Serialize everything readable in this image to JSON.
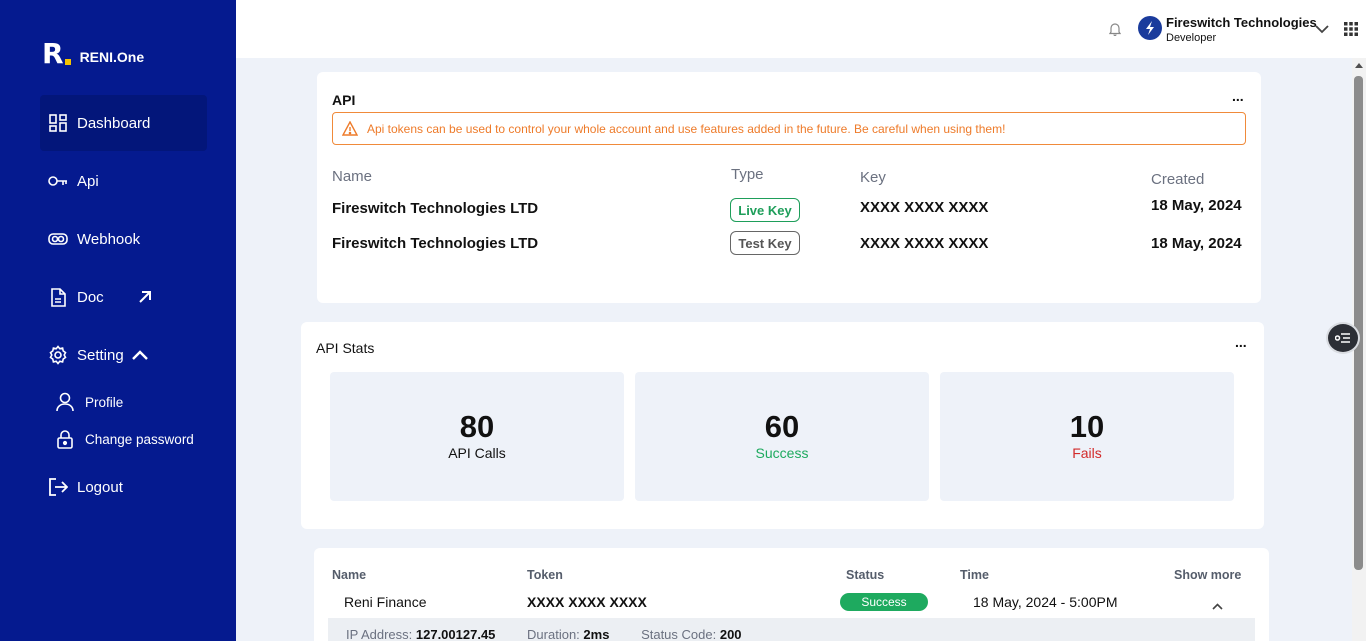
{
  "brand": {
    "mark": "R",
    "name": "RENI.One",
    "dot_color": "#f5c400",
    "sidebar_color": "#051a8f"
  },
  "sidebar": {
    "items": [
      {
        "label": "Dashboard",
        "icon": "dashboard-icon"
      },
      {
        "label": "Api",
        "icon": "key-icon"
      },
      {
        "label": "Webhook",
        "icon": "webhook-icon"
      },
      {
        "label": "Doc",
        "icon": "document-icon"
      },
      {
        "label": "Setting",
        "icon": "gear-icon"
      }
    ],
    "setting_sub": [
      {
        "label": "Profile",
        "icon": "user-icon"
      },
      {
        "label": "Change password",
        "icon": "lock-icon"
      }
    ],
    "logout_label": "Logout"
  },
  "topbar": {
    "user_name": "Fireswitch Technologies",
    "user_role": "Developer"
  },
  "api_card": {
    "title": "API",
    "menu": "...",
    "alert": "Api tokens can be used to control your whole account and use features added in the future. Be careful when using them!",
    "columns": {
      "name": "Name",
      "type": "Type",
      "key": "Key",
      "created": "Created"
    },
    "rows": [
      {
        "name": "Fireswitch Technologies LTD",
        "type": "Live Key",
        "key": "XXXX XXXX XXXX",
        "created": "18 May, 2024"
      },
      {
        "name": "Fireswitch Technologies LTD",
        "type": "Test Key",
        "key": "XXXX XXXX XXXX",
        "created": "18 May, 2024"
      }
    ]
  },
  "stats_card": {
    "title": "API Stats",
    "menu": "...",
    "stats": [
      {
        "value": "80",
        "label": "API Calls",
        "color": "#111111"
      },
      {
        "value": "60",
        "label": "Success",
        "color": "#1eaa5f"
      },
      {
        "value": "10",
        "label": "Fails",
        "color": "#d22b2b"
      }
    ]
  },
  "log_card": {
    "columns": {
      "name": "Name",
      "token": "Token",
      "status": "Status",
      "time": "Time",
      "more": "Show more"
    },
    "row": {
      "name": "Reni Finance",
      "token": "XXXX XXXX XXXX",
      "status": "Success",
      "time": "18 May, 2024 - 5:00PM"
    },
    "detail": {
      "ip_label": "IP Address:",
      "ip": "127.00127.45",
      "duration_label": "Duration:",
      "duration": "2ms",
      "status_code_label": "Status Code:",
      "status_code": "200"
    }
  }
}
